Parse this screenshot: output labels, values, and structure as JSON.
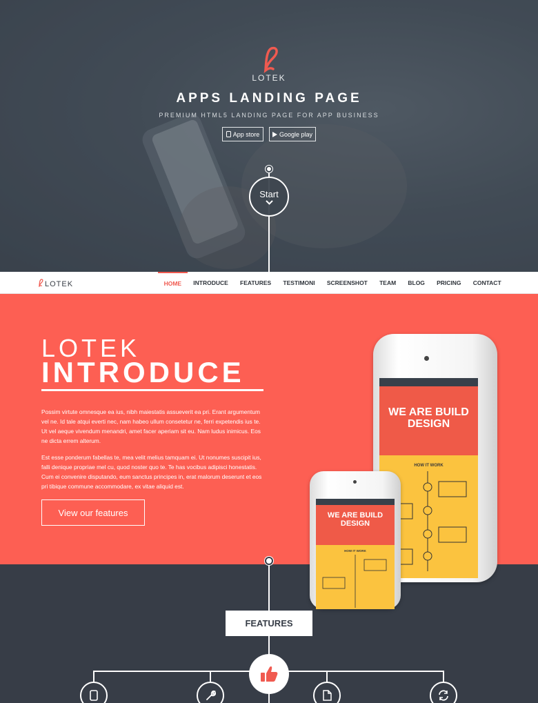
{
  "hero": {
    "logo_text": "LOTEK",
    "title": "APPS LANDING PAGE",
    "subtitle": "PREMIUM HTML5 LANDING PAGE FOR APP BUSINESS",
    "buttons": {
      "app_store": "App store",
      "google_play": "Google play"
    },
    "start_label": "Start"
  },
  "nav": {
    "logo_text": "LOTEK",
    "items": [
      "HOME",
      "INTRODUCE",
      "FEATURES",
      "TESTIMONI",
      "SCREENSHOT",
      "TEAM",
      "BLOG",
      "PRICING",
      "CONTACT"
    ],
    "active": "HOME"
  },
  "intro": {
    "title_small": "LOTEK",
    "title_big": "INTRODUCE",
    "paragraph1": "Possim virtute omnesque ea ius, nibh maiestatis assueverit ea pri. Erant argumentum vel ne. Id tale atqui everti nec, nam habeo ullum consetetur ne, ferri expetendis ius te. Ut vel aeque vivendum menandri, amet facer aperiam sit eu. Nam ludus inimicus. Eos ne dicta errem alterum.",
    "paragraph2": "Est esse ponderum fabellas te, mea velit melius tamquam ei. Ut nonumes suscipit ius, falli denique propriae mel cu, quod noster quo te. Te has vocibus adipisci honestatis. Cum ei convenire disputando, eum sanctus principes in, erat malorum deserunt et eos pri tibique commune accommodare, ex vitae aliquid est.",
    "cta": "View our features",
    "phone_screen_title_big": "WE ARE BUILD DESIGN",
    "phone_screen_how": "HOW IT WORK",
    "phone_screen_title_small": "WE ARE BUILD DESIGN",
    "phone_screen_how_small": "HOW IT WORK"
  },
  "features": {
    "title": "FEATURES",
    "icons": [
      "phone-icon",
      "wrench-icon",
      "document-icon",
      "refresh-icon"
    ],
    "center_icon": "thumbs-up-icon"
  },
  "colors": {
    "accent": "#fd5f53",
    "dark": "#373d47",
    "white": "#ffffff"
  }
}
